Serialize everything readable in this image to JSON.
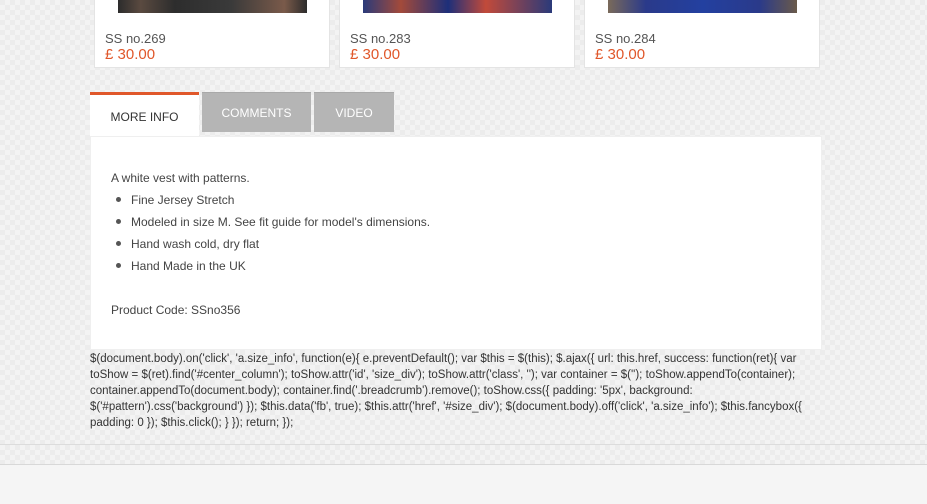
{
  "products": [
    {
      "name": "SS no.269",
      "price": "£ 30.00"
    },
    {
      "name": "SS no.283",
      "price": "£ 30.00"
    },
    {
      "name": "SS no.284",
      "price": "£ 30.00"
    }
  ],
  "tabs": {
    "more_info": "MORE INFO",
    "comments": "COMMENTS",
    "video": "VIDEO"
  },
  "info": {
    "intro": "A white vest with patterns.",
    "bullets": [
      "Fine Jersey Stretch",
      "Modeled in size M. See fit guide for model's dimensions.",
      "Hand wash cold, dry flat",
      "Hand Made in the UK"
    ],
    "product_code": "Product Code: SSno356"
  },
  "script_text": "$(document.body).on('click', 'a.size_info', function(e){ e.preventDefault(); var $this = $(this); $.ajax({ url: this.href, success: function(ret){ var toShow = $(ret).find('#center_column'); toShow.attr('id', 'size_div'); toShow.attr('class', ''); var container = $(''); toShow.appendTo(container); container.appendTo(document.body); container.find('.breadcrumb').remove(); toShow.css({ padding: '5px', background: $('#pattern').css('background') }); $this.data('fb', true); $this.attr('href', '#size_div'); $(document.body).off('click', 'a.size_info'); $this.fancybox({ padding: 0 }); $this.click(); } }); return; });",
  "colors": {
    "accent": "#e0572a",
    "tab_inactive": "#b5b5b5"
  }
}
